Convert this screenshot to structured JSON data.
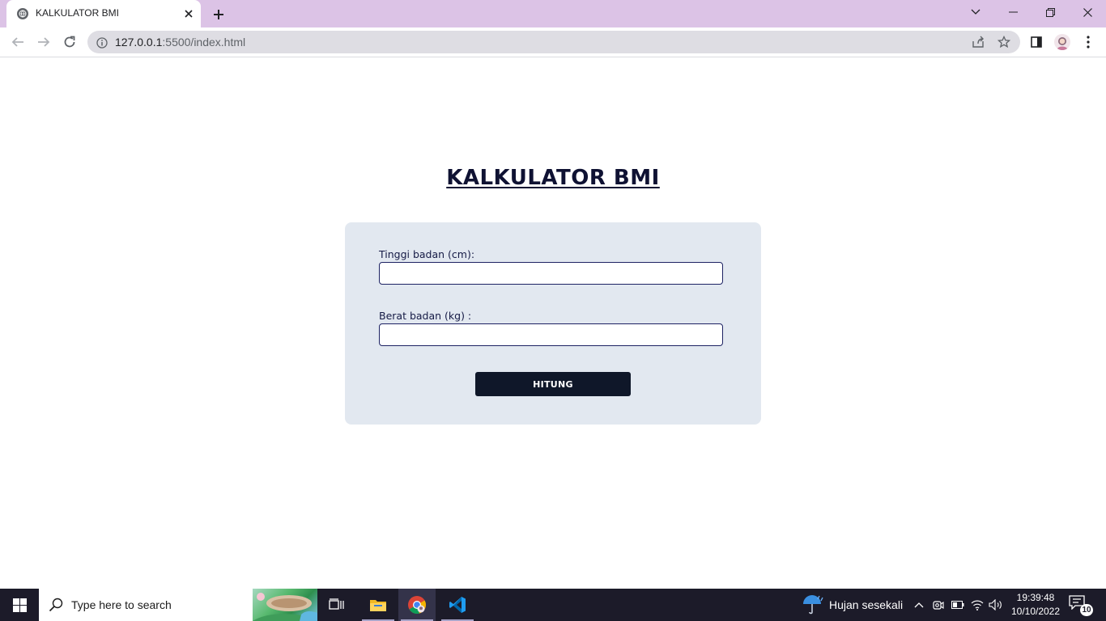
{
  "browser": {
    "tab_title": "KALKULATOR BMI",
    "url_host": "127.0.0.1",
    "url_rest": ":5500/index.html"
  },
  "page": {
    "title": "KALKULATOR BMI",
    "height_label": "Tinggi badan (cm):",
    "height_value": "",
    "weight_label": "Berat badan (kg) :",
    "weight_value": "",
    "button_label": "HITUNG"
  },
  "taskbar": {
    "search_placeholder": "Type here to search",
    "weather_text": "Hujan sesekali",
    "time": "19:39:48",
    "date": "10/10/2022",
    "notification_count": "10"
  },
  "colors": {
    "title": "#0f1233",
    "card_bg": "#e2e8f0",
    "button_bg": "#0f1729",
    "tabbar_bg": "#dcc3e6",
    "taskbar_bg": "#1c1b29"
  }
}
